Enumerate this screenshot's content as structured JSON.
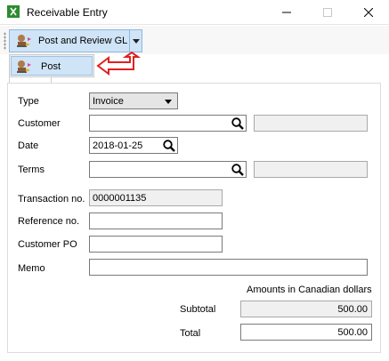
{
  "window": {
    "title": "Receivable Entry",
    "minimize_icon": "minimize-icon",
    "maximize_icon": "maximize-icon",
    "close_icon": "close-icon"
  },
  "toolbar": {
    "split_button_label": "Post and Review GL",
    "split_button_icon": "post-stamp-icon",
    "dropdown_icon": "chevron-down-icon"
  },
  "menu": {
    "items": [
      {
        "label": "Post",
        "icon": "post-stamp-icon"
      }
    ]
  },
  "annotation": {
    "arrow_icon": "red-arrow-icon",
    "color": "#e02020"
  },
  "form": {
    "type_label": "Type",
    "type_value": "Invoice",
    "customer_label": "Customer",
    "customer_value": "",
    "customer_name_value": "",
    "date_label": "Date",
    "date_value": "2018-01-25",
    "terms_label": "Terms",
    "terms_value": "",
    "terms_desc_value": "",
    "transaction_label": "Transaction no.",
    "transaction_value": "0000001135",
    "reference_label": "Reference no.",
    "reference_value": "",
    "customer_po_label": "Customer PO",
    "customer_po_value": "",
    "memo_label": "Memo",
    "memo_value": "",
    "currency_note": "Amounts in Canadian dollars",
    "subtotal_label": "Subtotal",
    "subtotal_value": "500.00",
    "total_label": "Total",
    "total_value": "500.00"
  }
}
